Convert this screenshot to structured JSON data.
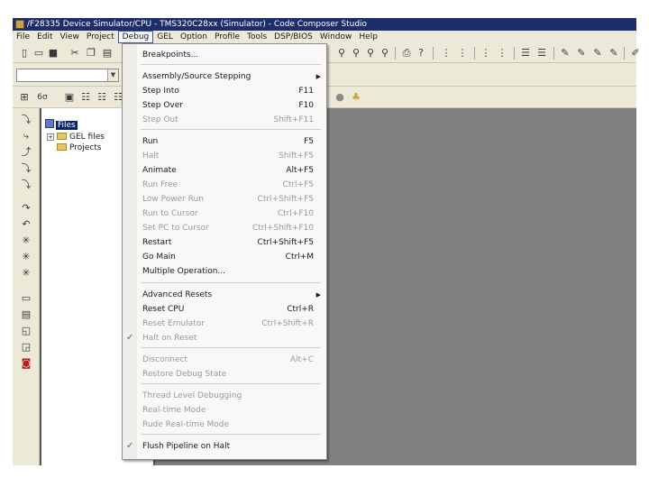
{
  "window": {
    "title": "/F28335 Device Simulator/CPU - TMS320C28xx (Simulator) - Code Composer Studio"
  },
  "menubar": {
    "items": [
      "File",
      "Edit",
      "View",
      "Project",
      "Debug",
      "GEL",
      "Option",
      "Profile",
      "Tools",
      "DSP/BIOS",
      "Window",
      "Help"
    ],
    "active": "Debug"
  },
  "project_tree": {
    "root_label": "Files",
    "items": [
      {
        "label": "GEL files",
        "expander": "+"
      },
      {
        "label": "Projects",
        "expander": ""
      }
    ]
  },
  "debug_menu": {
    "items": [
      {
        "label": "Breakpoints...",
        "shortcut": "",
        "enabled": true,
        "submenu": false,
        "checked": false
      },
      {
        "label": "Assembly/Source Stepping",
        "shortcut": "",
        "enabled": true,
        "submenu": true,
        "checked": false
      },
      {
        "label": "Step Into",
        "shortcut": "F11",
        "enabled": true,
        "submenu": false,
        "checked": false
      },
      {
        "label": "Step Over",
        "shortcut": "F10",
        "enabled": true,
        "submenu": false,
        "checked": false
      },
      {
        "label": "Step Out",
        "shortcut": "Shift+F11",
        "enabled": false,
        "submenu": false,
        "checked": false
      },
      {
        "label": "Run",
        "shortcut": "F5",
        "enabled": true,
        "submenu": false,
        "checked": false
      },
      {
        "label": "Halt",
        "shortcut": "Shift+F5",
        "enabled": false,
        "submenu": false,
        "checked": false
      },
      {
        "label": "Animate",
        "shortcut": "Alt+F5",
        "enabled": true,
        "submenu": false,
        "checked": false
      },
      {
        "label": "Run Free",
        "shortcut": "Ctrl+F5",
        "enabled": false,
        "submenu": false,
        "checked": false
      },
      {
        "label": "Low Power Run",
        "shortcut": "Ctrl+Shift+F5",
        "enabled": false,
        "submenu": false,
        "checked": false
      },
      {
        "label": "Run to Cursor",
        "shortcut": "Ctrl+F10",
        "enabled": false,
        "submenu": false,
        "checked": false
      },
      {
        "label": "Set PC to Cursor",
        "shortcut": "Ctrl+Shift+F10",
        "enabled": false,
        "submenu": false,
        "checked": false
      },
      {
        "label": "Restart",
        "shortcut": "Ctrl+Shift+F5",
        "enabled": true,
        "submenu": false,
        "checked": false
      },
      {
        "label": "Go Main",
        "shortcut": "Ctrl+M",
        "enabled": true,
        "submenu": false,
        "checked": false
      },
      {
        "label": "Multiple Operation...",
        "shortcut": "",
        "enabled": true,
        "submenu": false,
        "checked": false
      },
      {
        "label": "Advanced Resets",
        "shortcut": "",
        "enabled": true,
        "submenu": true,
        "checked": false
      },
      {
        "label": "Reset CPU",
        "shortcut": "Ctrl+R",
        "enabled": true,
        "submenu": false,
        "checked": false
      },
      {
        "label": "Reset Emulator",
        "shortcut": "Ctrl+Shift+R",
        "enabled": false,
        "submenu": false,
        "checked": false
      },
      {
        "label": "Halt on Reset",
        "shortcut": "",
        "enabled": false,
        "submenu": false,
        "checked": true
      },
      {
        "label": "Disconnect",
        "shortcut": "Alt+C",
        "enabled": false,
        "submenu": false,
        "checked": false
      },
      {
        "label": "Restore Debug State",
        "shortcut": "",
        "enabled": false,
        "submenu": false,
        "checked": false
      },
      {
        "label": "Thread Level Debugging",
        "shortcut": "",
        "enabled": false,
        "submenu": false,
        "checked": false
      },
      {
        "label": "Real-time Mode",
        "shortcut": "",
        "enabled": false,
        "submenu": false,
        "checked": false
      },
      {
        "label": "Rude Real-time Mode",
        "shortcut": "",
        "enabled": false,
        "submenu": false,
        "checked": false
      },
      {
        "label": "Flush Pipeline on Halt",
        "shortcut": "",
        "enabled": true,
        "submenu": false,
        "checked": true
      }
    ]
  }
}
